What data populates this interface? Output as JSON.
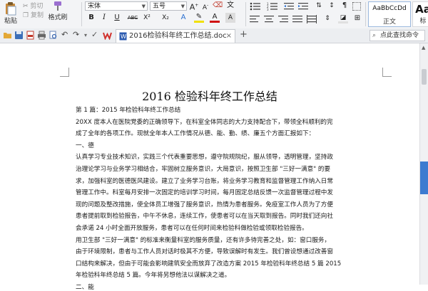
{
  "ribbon": {
    "paste_label": "粘贴",
    "cut_label": "剪切",
    "copy_label": "复制",
    "format_painter_label": "格式刷",
    "font_name": "宋体",
    "font_size": "五号",
    "bold": "B",
    "italic": "I",
    "underline": "U",
    "strike": "ABC",
    "superscript": "X²",
    "subscript": "X₂",
    "font_color": "A",
    "style_normal_preview": "AaBbCcDd",
    "style_normal_label": "正文",
    "style_heading_preview": "Aa",
    "style_heading_label": "标"
  },
  "tabbar": {
    "document_tab": "2016检验科年终工作总结.doc",
    "search_placeholder": "点此查找命令"
  },
  "document": {
    "title": "2016 检验科年终工作总结",
    "lines": [
      "第 1 篇：2015 年检验科年终工作总结",
      "20XX 度本人在医院党委的正确领导下，在科室全体同志的大力支持配合下，带领全科顺利的完",
      "成了全年的各项工作。现就全年本人工作情况从德、能、勤、绩、廉五个方面汇报如下：",
      "一、德",
      "认真学习专业技术知识，实践三个代表重要思想，遵守院规院纪，服从领导，透明管理，坚持政",
      "治理论学习与业务学习相结合，牢固树立服务意识，大局意识，按照卫生部 \"三好一满意\" 的要",
      "求，加强科室的医德医风建设。建立了业务学习台账，将业务学习教育和监督管理工作纳入日常",
      "管理工作中。科室每月安排一次固定的培训学习时间，每月固定总结反馈一次监督管理过程中发",
      "现的问题及整改措施，使全体员工增强了服务意识，热情为患者服务。免疫室工作人员为了方便",
      "患者提前取到检验报告，中午不休息，连续工作，使患者可以在当天取到报告。同时我们还向社",
      "会承诺 24 小时全面开放服务，患者可以在任何时间来检验科做检验或领取检验报告。",
      "用卫生部 \"三好一满意\" 的标准来衡量科室的服务质量，还有许多待完善之处，如：窗口服务，",
      "由于环境限制，患者与工作人员对话时极其不方便，导致误解时有发生。我们曾设想通过改善窗",
      "口结构来解决，但由于可能会影响建筑安全而放弃了改造方案 2015 年检验科年终总结 5 篇 2015",
      "年检验科年终总结 5 篇。今年将另想他法以谋解决之道。",
      "二、能"
    ]
  }
}
